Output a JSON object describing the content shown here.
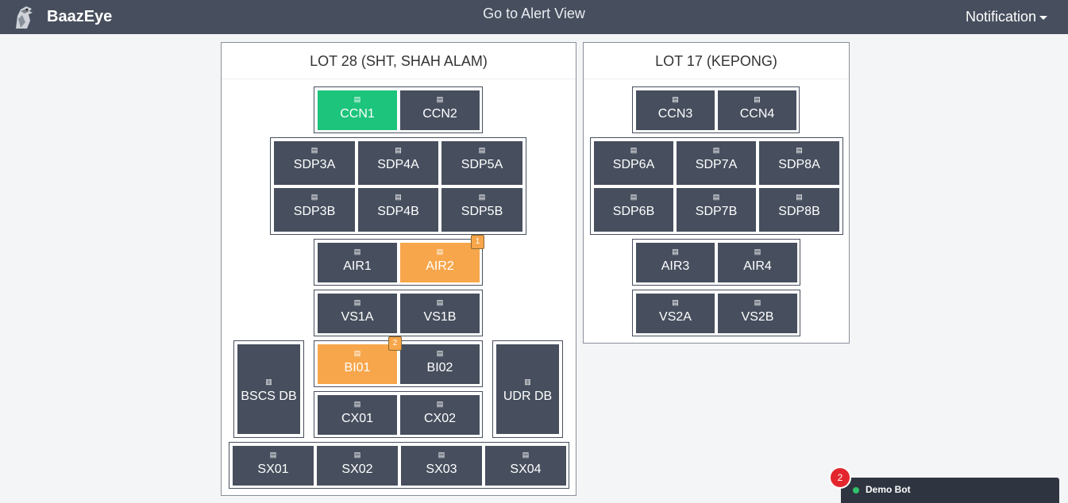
{
  "header": {
    "brand": "BaazEye",
    "alert_view": "Go to Alert View",
    "notification": "Notification",
    "logo_icon": "hawk-logo-icon"
  },
  "node_icon": "▤",
  "db_icon": "▥",
  "lot28": {
    "title": "LOT 28 (SHT, SHAH ALAM)",
    "ccn": [
      "CCN1",
      "CCN2"
    ],
    "sdp": [
      "SDP3A",
      "SDP4A",
      "SDP5A",
      "SDP3B",
      "SDP4B",
      "SDP5B"
    ],
    "air": [
      "AIR1",
      "AIR2"
    ],
    "air_badge": "1",
    "vs": [
      "VS1A",
      "VS1B"
    ],
    "bi": [
      "BI01",
      "BI02"
    ],
    "bi_badge": "2",
    "cx": [
      "CX01",
      "CX02"
    ],
    "bscs": "BSCS DB",
    "udr": "UDR DB",
    "sx": [
      "SX01",
      "SX02",
      "SX03",
      "SX04"
    ]
  },
  "lot17": {
    "title": "LOT 17 (KEPONG)",
    "ccn": [
      "CCN3",
      "CCN4"
    ],
    "sdp": [
      "SDP6A",
      "SDP7A",
      "SDP8A",
      "SDP6B",
      "SDP7B",
      "SDP8B"
    ],
    "air": [
      "AIR3",
      "AIR4"
    ],
    "vs": [
      "VS2A",
      "VS2B"
    ]
  },
  "status_colors": {
    "ok": "#1dc47b",
    "warning": "#f7a64b",
    "default": "#474f5e"
  },
  "chatbot": {
    "name": "Demo Bot",
    "unread": "2",
    "status": "online"
  }
}
